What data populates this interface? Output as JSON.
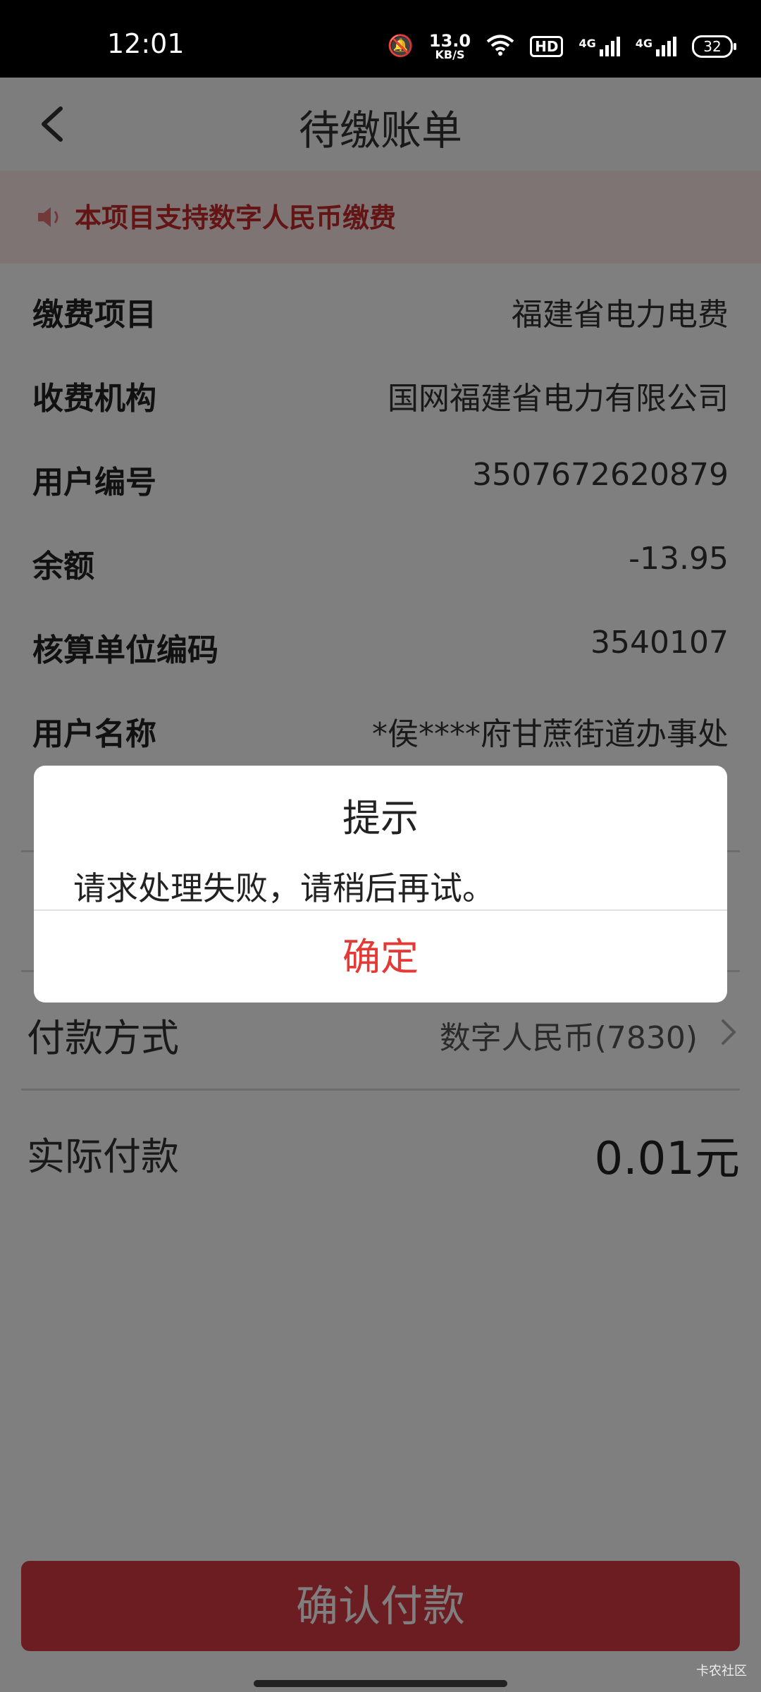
{
  "status_bar": {
    "time": "12:01",
    "net_speed_value": "13.0",
    "net_speed_unit": "KB/S",
    "hd_label": "HD",
    "signal1_label": "4G",
    "signal2_label": "4G",
    "battery": "32"
  },
  "header": {
    "title": "待缴账单"
  },
  "notice": {
    "text": "本项目支持数字人民币缴费"
  },
  "info_rows": [
    {
      "label": "缴费项目",
      "value": "福建省电力电费"
    },
    {
      "label": "收费机构",
      "value": "国网福建省电力有限公司"
    },
    {
      "label": "用户编号",
      "value": "3507672620879"
    },
    {
      "label": "余额",
      "value": "-13.95"
    },
    {
      "label": "核算单位编码",
      "value": "3540107"
    },
    {
      "label": "用户名称",
      "value": "*侯****府甘蔗街道办事处"
    }
  ],
  "payment": {
    "method_label": "付款方式",
    "method_value": "数字人民币(7830)",
    "actual_label": "实际付款",
    "actual_value": "0.01元"
  },
  "confirm_button": "确认付款",
  "dialog": {
    "title": "提示",
    "message": "请求处理失败，请稍后再试。",
    "ok": "确定"
  },
  "watermark": "卡农社区",
  "colors": {
    "accent": "#d93a44",
    "notice_text": "#c62828",
    "dialog_ok": "#e53935"
  }
}
